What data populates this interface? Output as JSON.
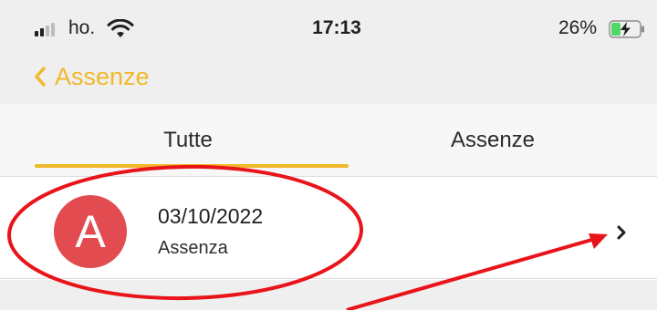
{
  "status_bar": {
    "carrier": "ho.",
    "time": "17:13",
    "battery_percent": "26%",
    "battery_level": 0.26,
    "icons": [
      "signal-icon",
      "wifi-icon",
      "battery-charging-icon"
    ]
  },
  "nav": {
    "back_label": "Assenze",
    "back_icon": "chevron-left-icon"
  },
  "tabs": [
    {
      "label": "Tutte",
      "selected": true
    },
    {
      "label": "Assenze",
      "selected": false
    }
  ],
  "list": {
    "items": [
      {
        "avatar_letter": "A",
        "date": "03/10/2022",
        "type": "Assenza",
        "icon": "chevron-right-icon"
      }
    ]
  },
  "colors": {
    "accent": "#f0b92b",
    "avatar_bg": "#e24b4f",
    "annotation": "#e8141a",
    "battery_green": "#4cd964"
  }
}
